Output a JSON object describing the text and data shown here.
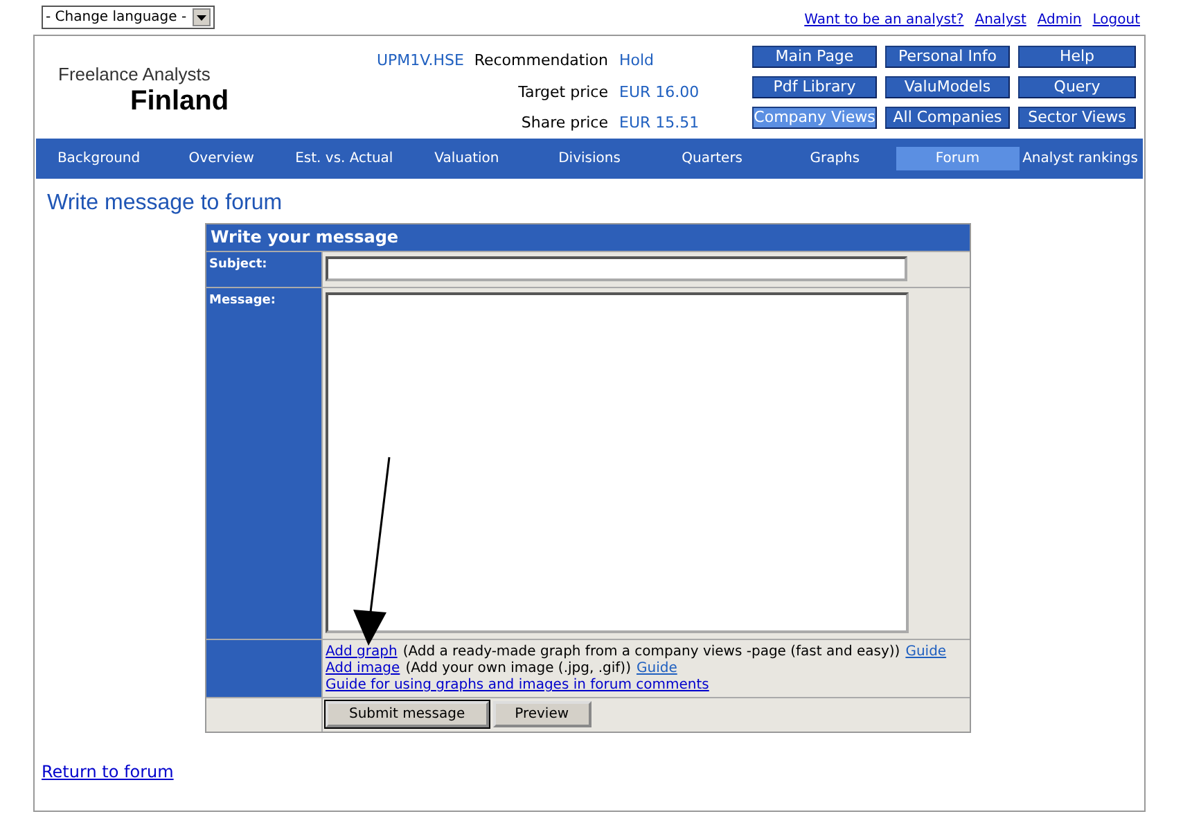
{
  "language_select": {
    "value": "- Change language -"
  },
  "top_links": [
    "Want to be an analyst?",
    "Analyst",
    "Admin",
    "Logout"
  ],
  "logo": {
    "line_1": "Freelance Analysts",
    "line_2": "Finland"
  },
  "ticker": "UPM1V.HSE",
  "info": [
    {
      "label": "Recommendation",
      "value": "Hold"
    },
    {
      "label": "Target price",
      "value": "EUR 16.00"
    },
    {
      "label": "Share price",
      "value": "EUR 15.51"
    }
  ],
  "menu_buttons": [
    {
      "label": "Main Page",
      "selected": false
    },
    {
      "label": "Personal Info",
      "selected": false
    },
    {
      "label": "Help",
      "selected": false
    },
    {
      "label": "Pdf Library",
      "selected": false
    },
    {
      "label": "ValuModels",
      "selected": false
    },
    {
      "label": "Query",
      "selected": false
    },
    {
      "label": "Company Views",
      "selected": true
    },
    {
      "label": "All Companies",
      "selected": false
    },
    {
      "label": "Sector Views",
      "selected": false
    }
  ],
  "tabs": [
    {
      "label": "Background",
      "selected": false
    },
    {
      "label": "Overview",
      "selected": false
    },
    {
      "label": "Est. vs. Actual",
      "selected": false
    },
    {
      "label": "Valuation",
      "selected": false
    },
    {
      "label": "Divisions",
      "selected": false
    },
    {
      "label": "Quarters",
      "selected": false
    },
    {
      "label": "Graphs",
      "selected": false
    },
    {
      "label": "Forum",
      "selected": true
    },
    {
      "label": "Analyst rankings",
      "selected": false
    }
  ],
  "heading": "Write message to forum",
  "form": {
    "title": "Write your message",
    "subject_label": "Subject:",
    "message_label": "Message:",
    "help_lines": [
      {
        "link": "Add graph",
        "text": "(Add a ready-made graph from a company views -page (fast and easy))",
        "guide": "Guide"
      },
      {
        "link": "Add image",
        "text": "(Add your own image (.jpg, .gif))",
        "guide": "Guide"
      },
      {
        "link": "Guide for using graphs and images in forum comments"
      }
    ],
    "buttons": [
      {
        "label": "Submit message",
        "kind": "default"
      },
      {
        "label": "Preview",
        "kind": "plain"
      }
    ]
  },
  "return_link": "Return to forum"
}
